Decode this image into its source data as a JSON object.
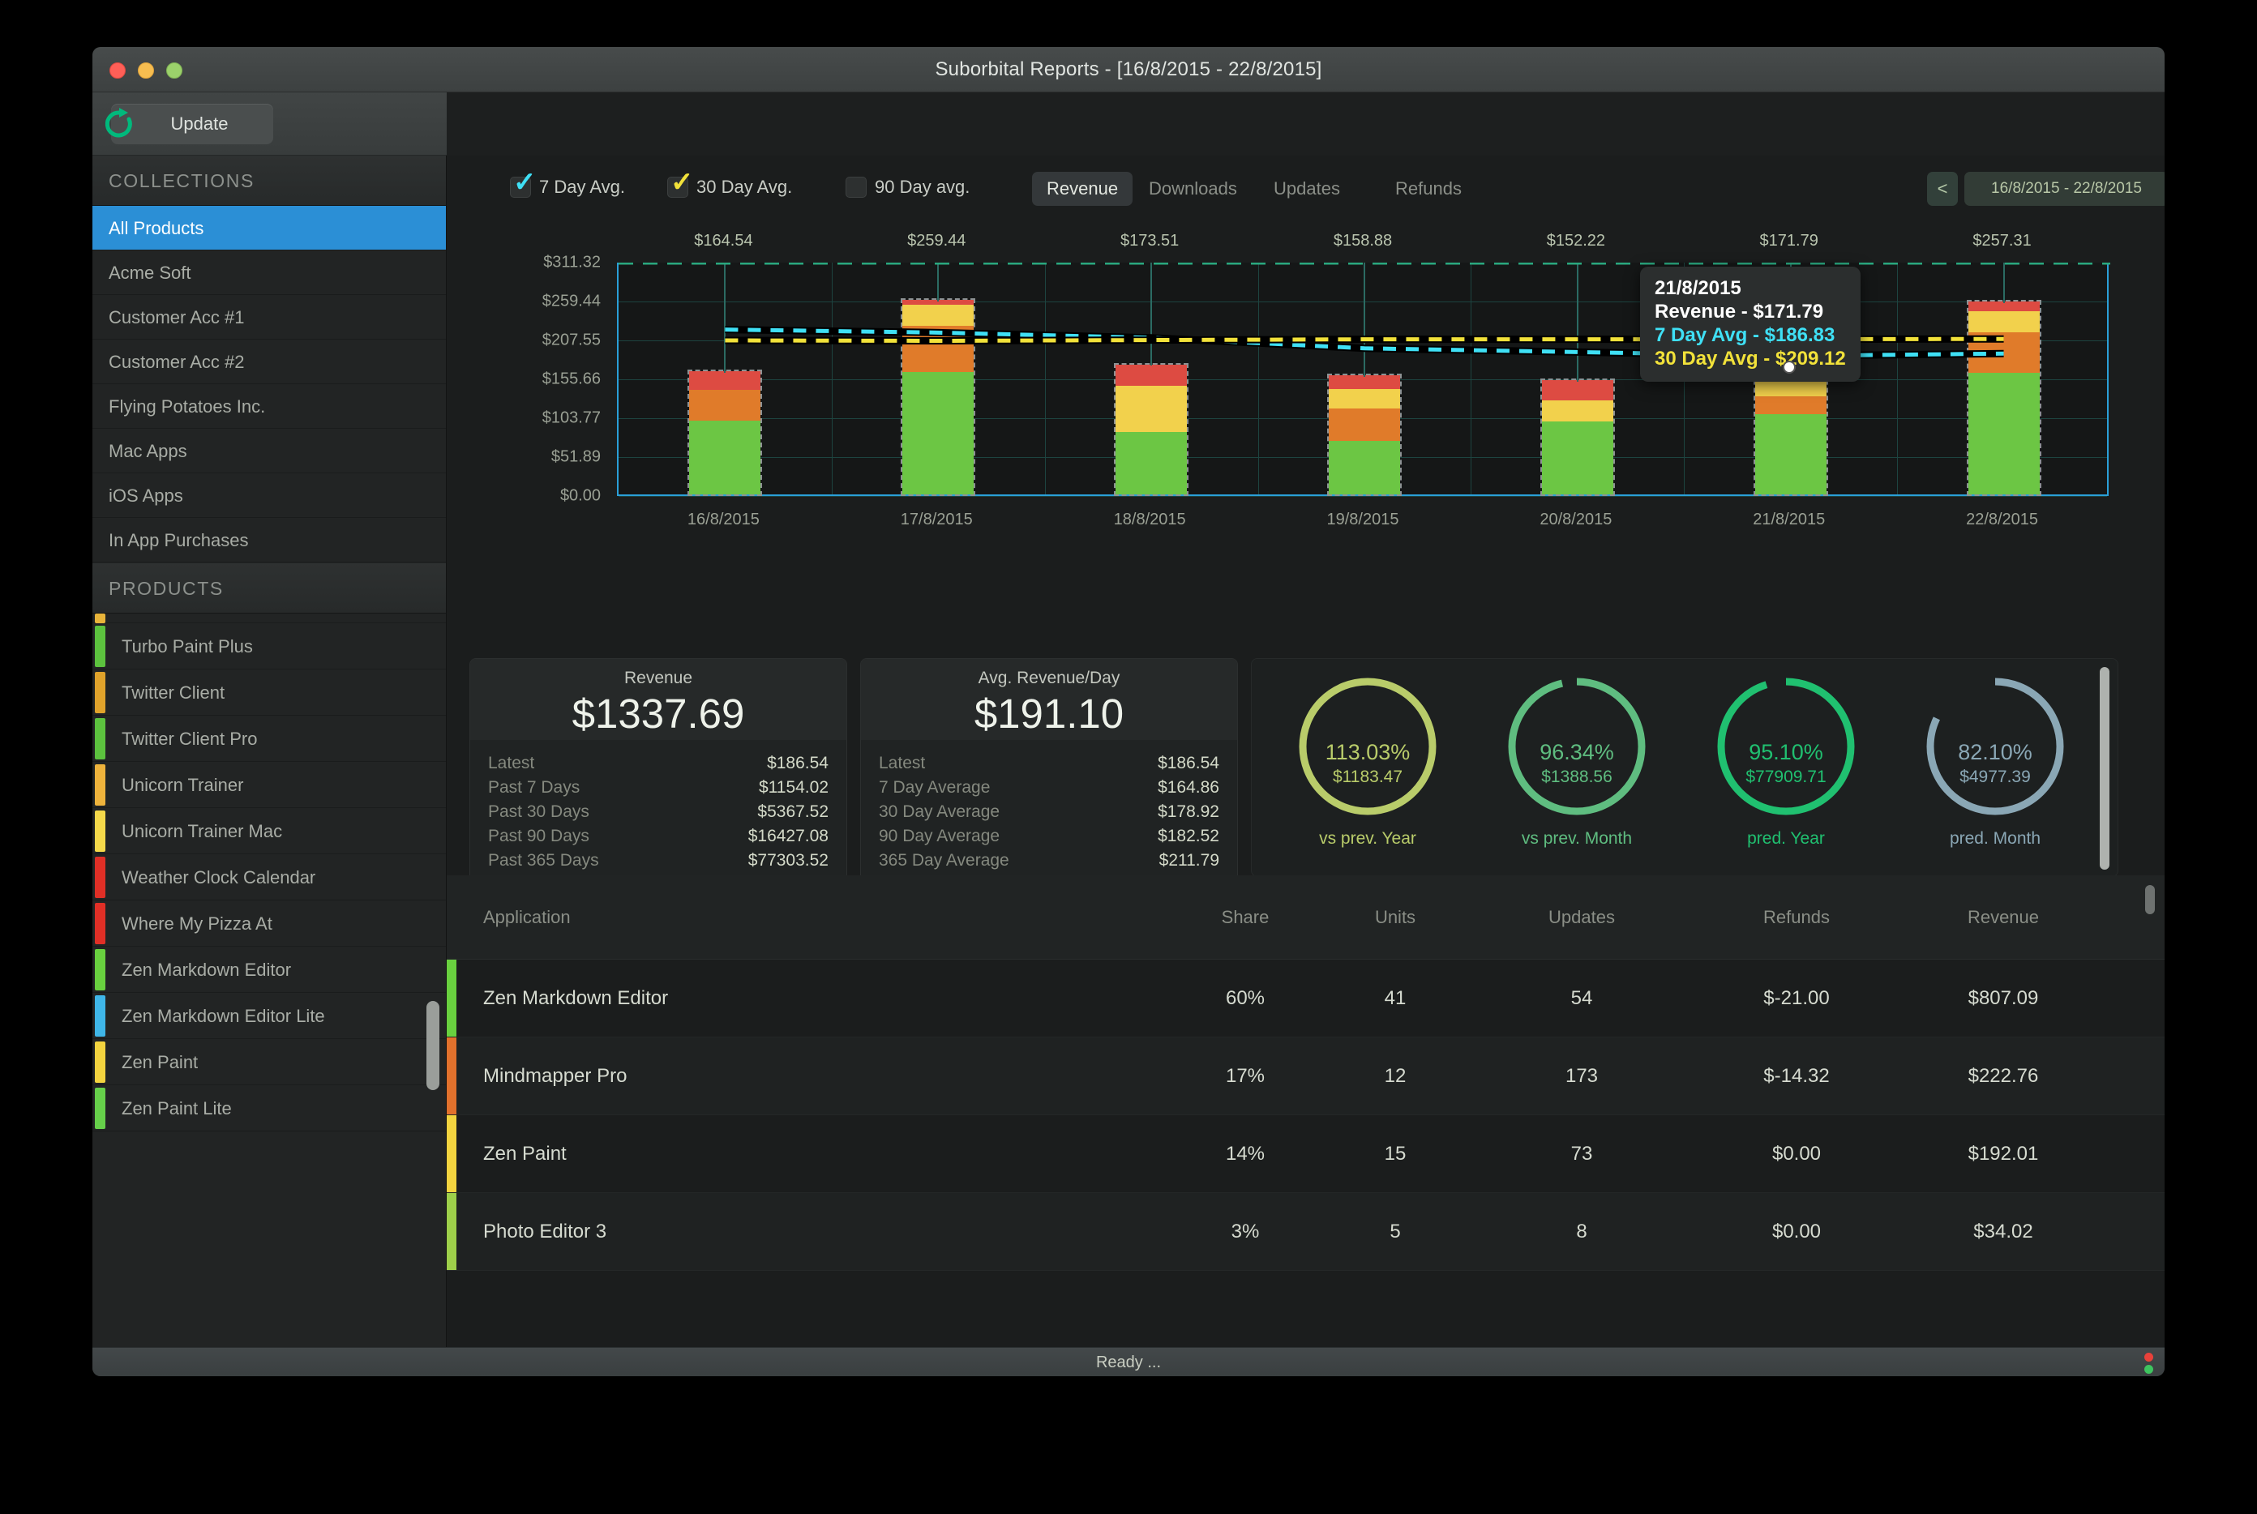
{
  "window": {
    "title": "Suborbital Reports - [16/8/2015 - 22/8/2015]",
    "traffic_lights": [
      "close",
      "minimize",
      "maximize"
    ]
  },
  "toolbar": {
    "update_label": "Update",
    "update_icon": "refresh-icon",
    "accent": "#00b97c"
  },
  "sidebar": {
    "collections_header": "COLLECTIONS",
    "collections": [
      {
        "label": "All Products",
        "selected": true
      },
      {
        "label": "Acme Soft",
        "selected": false
      },
      {
        "label": "Customer Acc #1",
        "selected": false
      },
      {
        "label": "Customer Acc #2",
        "selected": false
      },
      {
        "label": "Flying Potatoes Inc.",
        "selected": false
      },
      {
        "label": "Mac Apps",
        "selected": false
      },
      {
        "label": "iOS Apps",
        "selected": false
      },
      {
        "label": "In App Purchases",
        "selected": false
      }
    ],
    "products_header": "PRODUCTS",
    "products": [
      {
        "label": "Turbo Paint Plus",
        "color": "#5cc23e"
      },
      {
        "label": "Twitter Client",
        "color": "#e0a32b"
      },
      {
        "label": "Twitter Client Pro",
        "color": "#5cc23e"
      },
      {
        "label": "Unicorn Trainer",
        "color": "#eeb33c"
      },
      {
        "label": "Unicorn Trainer Mac",
        "color": "#f5d94a"
      },
      {
        "label": "Weather Clock Calendar",
        "color": "#e02f26"
      },
      {
        "label": "Where My Pizza At",
        "color": "#e02f26"
      },
      {
        "label": "Zen Markdown Editor",
        "color": "#69d13f"
      },
      {
        "label": "Zen Markdown Editor Lite",
        "color": "#3fb6e8"
      },
      {
        "label": "Zen Paint",
        "color": "#f3d43f"
      },
      {
        "label": "Zen Paint Lite",
        "color": "#66d04a"
      }
    ],
    "products_partial_top_color": "#e8b43a",
    "selected_color": "#2b8fd6"
  },
  "chart_controls": {
    "checkboxes": [
      {
        "label": "7 Day Avg.",
        "checked": true,
        "color": "#3fe0f5"
      },
      {
        "label": "30 Day Avg.",
        "checked": true,
        "color": "#f2e23a"
      },
      {
        "label": "90 Day avg.",
        "checked": false,
        "color": "#888888"
      }
    ],
    "tabs": [
      {
        "label": "Revenue",
        "active": true
      },
      {
        "label": "Downloads",
        "active": false
      },
      {
        "label": "Updates",
        "active": false
      },
      {
        "label": "Refunds",
        "active": false
      }
    ],
    "date_prev": "<",
    "date_next": ">",
    "date_range": "16/8/2015 - 22/8/2015"
  },
  "chart_data": {
    "type": "bar",
    "title": "Revenue",
    "xlabel": "",
    "ylabel": "Revenue",
    "stacked": true,
    "grid": true,
    "legend_position": "top-left",
    "ylim": [
      0,
      311.32
    ],
    "ytick_labels": [
      "$311.32",
      "$259.44",
      "$207.55",
      "$155.66",
      "$103.77",
      "$51.89",
      "$0.00"
    ],
    "ytick_values": [
      311.32,
      259.44,
      207.55,
      155.66,
      103.77,
      51.89,
      0.0
    ],
    "categories": [
      "16/8/2015",
      "17/8/2015",
      "18/8/2015",
      "19/8/2015",
      "20/8/2015",
      "21/8/2015",
      "22/8/2015"
    ],
    "values": [
      164.54,
      259.44,
      173.51,
      158.88,
      152.22,
      171.79,
      257.31
    ],
    "value_labels": [
      "$164.54",
      "$259.44",
      "$173.51",
      "$158.88",
      "$152.22",
      "$171.79",
      "$257.31"
    ],
    "segment_colors": [
      "#6cc644",
      "#e07b2a",
      "#f2d14c",
      "#dd4b42"
    ],
    "stack_series": [
      {
        "name": "green",
        "color": "#6cc644",
        "values": [
          98.0,
          163.0,
          83.0,
          71.0,
          97.0,
          107.0,
          162.0
        ]
      },
      {
        "name": "orange",
        "color": "#e07b2a",
        "values": [
          42.0,
          62.0,
          0.0,
          44.0,
          0.0,
          24.0,
          54.0
        ]
      },
      {
        "name": "yellow",
        "color": "#f2d14c",
        "values": [
          0.0,
          28.0,
          62.0,
          26.0,
          28.0,
          29.0,
          28.0
        ]
      },
      {
        "name": "red",
        "color": "#dd4b42",
        "values": [
          24.5,
          6.4,
          28.5,
          17.9,
          27.2,
          11.8,
          13.3
        ]
      }
    ],
    "trend_lines": [
      {
        "name": "7 Day Avg.",
        "color": "#3fe0f5",
        "style": "dashed",
        "values": [
          222.0,
          218.0,
          211.0,
          197.0,
          192.0,
          186.83,
          190.0
        ]
      },
      {
        "name": "30 Day Avg.",
        "color": "#f2e23a",
        "style": "dashed",
        "values": [
          207.55,
          207.0,
          208.0,
          209.0,
          209.0,
          209.12,
          209.5
        ]
      }
    ],
    "tooltip": {
      "date": "21/8/2015",
      "revenue": "Revenue - $171.79",
      "avg7": "7 Day Avg - $186.83",
      "avg30": "30 Day Avg - $209.12",
      "avg7_color": "#3fe0f5",
      "avg30_color": "#f2e23a"
    }
  },
  "stats": {
    "revenue_card": {
      "title": "Revenue",
      "big": "$1337.69",
      "rows": [
        {
          "k": "Latest",
          "v": "$186.54"
        },
        {
          "k": "Past 7 Days",
          "v": "$1154.02"
        },
        {
          "k": "Past 30 Days",
          "v": "$5367.52"
        },
        {
          "k": "Past 90 Days",
          "v": "$16427.08"
        },
        {
          "k": "Past 365 Days",
          "v": "$77303.52"
        }
      ]
    },
    "avg_card": {
      "title": "Avg. Revenue/Day",
      "big": "$191.10",
      "rows": [
        {
          "k": "Latest",
          "v": "$186.54"
        },
        {
          "k": "7 Day Average",
          "v": "$164.86"
        },
        {
          "k": "30 Day Average",
          "v": "$178.92"
        },
        {
          "k": "90 Day Average",
          "v": "$182.52"
        },
        {
          "k": "365 Day Average",
          "v": "$211.79"
        }
      ]
    },
    "gauges": [
      {
        "pct": "113.03%",
        "value": "$1183.47",
        "caption": "vs prev. Year",
        "color": "#b9cc6a",
        "fraction": 1.0
      },
      {
        "pct": "96.34%",
        "value": "$1388.56",
        "caption": "vs prev. Month",
        "color": "#5fbd80",
        "fraction": 0.9634
      },
      {
        "pct": "95.10%",
        "value": "$77909.71",
        "caption": "pred. Year",
        "color": "#20c070",
        "fraction": 0.951
      },
      {
        "pct": "82.10%",
        "value": "$4977.39",
        "caption": "pred. Month",
        "color": "#8aa7b5",
        "fraction": 0.821
      }
    ]
  },
  "table": {
    "headers": {
      "application": "Application",
      "share": "Share",
      "units": "Units",
      "updates": "Updates",
      "refunds": "Refunds",
      "revenue": "Revenue"
    },
    "rows": [
      {
        "app": "Zen Markdown Editor",
        "share": "60%",
        "units": "41",
        "updates": "54",
        "refunds": "$-21.00",
        "revenue": "$807.09",
        "color": "#69d13f"
      },
      {
        "app": "Mindmapper Pro",
        "share": "17%",
        "units": "12",
        "updates": "173",
        "refunds": "$-14.32",
        "revenue": "$222.76",
        "color": "#e2712c"
      },
      {
        "app": "Zen Paint",
        "share": "14%",
        "units": "15",
        "updates": "73",
        "refunds": "$0.00",
        "revenue": "$192.01",
        "color": "#f3d43f"
      },
      {
        "app": "Photo Editor 3",
        "share": "3%",
        "units": "5",
        "updates": "8",
        "refunds": "$0.00",
        "revenue": "$34.02",
        "color": "#9ed04a"
      }
    ]
  },
  "statusbar": {
    "text": "Ready ...",
    "led_red": "#e8413a",
    "led_green": "#3ec45f"
  }
}
